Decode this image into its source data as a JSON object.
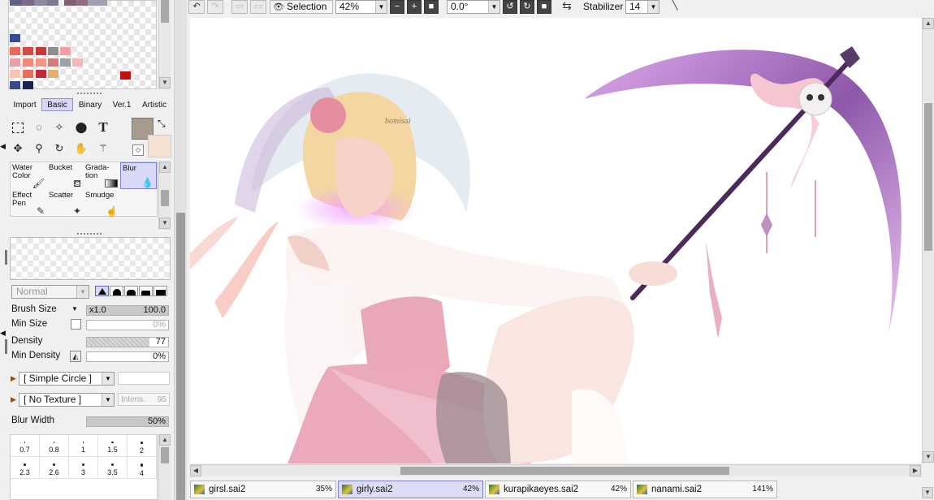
{
  "toolbar": {
    "selection_label": "Selection",
    "zoom_value": "42%",
    "rotation_value": "0.0°",
    "stabilizer_label": "Stabilizer",
    "stabilizer_value": "14"
  },
  "palette_colors": [
    "#e8685a",
    "#d44b44",
    "#c43a3a",
    "#8e8e8e",
    "#f2a0a8",
    "#e8a0a8",
    "#f28878",
    "#f29486",
    "#d47a7a",
    "#9aa4a4",
    "#f4b8b0",
    "#f8c4b4",
    "#e86e5a",
    "#c02a3a",
    "#e4b070",
    "#c01010",
    "#3a4a88",
    "#1a2450"
  ],
  "brush_tabs": [
    {
      "label": "Import"
    },
    {
      "label": "Basic"
    },
    {
      "label": "Binary"
    },
    {
      "label": "Ver.1"
    },
    {
      "label": "Artistic"
    }
  ],
  "brushes": [
    {
      "line1": "Water",
      "line2": "Color"
    },
    {
      "line1": "Bucket",
      "line2": ""
    },
    {
      "line1": "Grada-",
      "line2": "tion"
    },
    {
      "line1": "Blur",
      "line2": ""
    },
    {
      "line1": "Effect",
      "line2": "Pen"
    },
    {
      "line1": "Scatter",
      "line2": ""
    },
    {
      "line1": "Smudge",
      "line2": ""
    }
  ],
  "brush_settings": {
    "blend_mode": "Normal",
    "brush_size_label": "Brush Size",
    "brush_size_multiplier": "x1.0",
    "brush_size_value": "100.0",
    "min_size_label": "Min Size",
    "min_size_value": "0%",
    "density_label": "Density",
    "density_value": "77",
    "min_density_label": "Min Density",
    "min_density_value": "0%",
    "shape_value": "[ Simple Circle ]",
    "texture_value": "[ No Texture ]",
    "intensity_label": "Intens.",
    "intensity_value": "95",
    "blur_width_label": "Blur Width",
    "blur_width_value": "50%"
  },
  "brush_size_presets": [
    "0.7",
    "0.8",
    "1",
    "1.5",
    "2",
    "2.3",
    "2.6",
    "3",
    "3.5",
    "4"
  ],
  "canvas": {
    "watermark": "bomisai"
  },
  "document_tabs": [
    {
      "name": "girsl.sai2",
      "zoom": "35%"
    },
    {
      "name": "girly.sai2",
      "zoom": "42%"
    },
    {
      "name": "kurapikaeyes.sai2",
      "zoom": "42%"
    },
    {
      "name": "nanami.sai2",
      "zoom": "141%"
    }
  ],
  "colors": {
    "main_color": "#a99a8e",
    "sub_color": "#f6e2d2",
    "accent": "#d7d7f7"
  }
}
